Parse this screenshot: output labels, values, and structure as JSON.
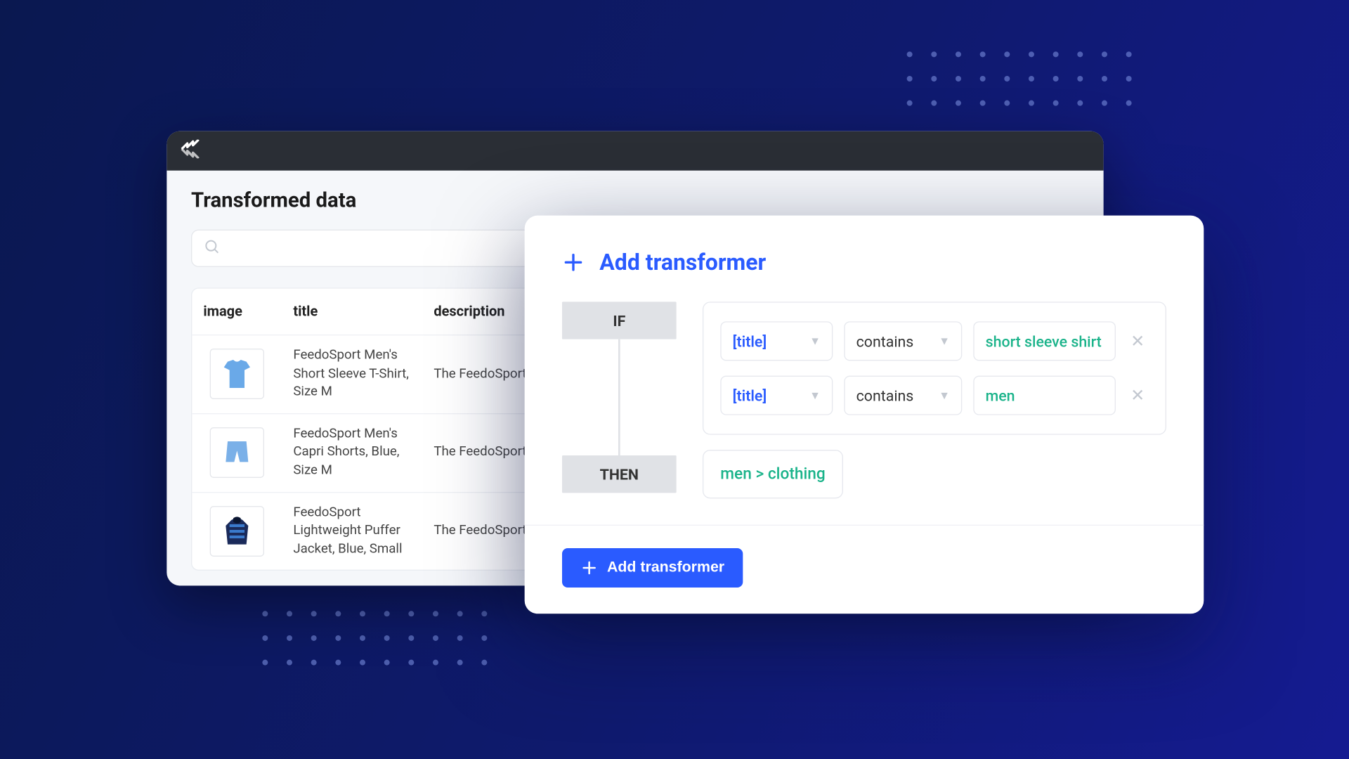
{
  "dataWindow": {
    "title": "Transformed data",
    "columns": {
      "image": "image",
      "title": "title",
      "description": "description"
    },
    "rows": [
      {
        "title": "FeedoSport Men's Short Sleeve T-Shirt, Size M",
        "desc": "The FeedoSport Short Sleeve T-Shirt is built for comfort and every day wear"
      },
      {
        "title": "FeedoSport Men's Capri Shorts, Blue, Size M",
        "desc": "The FeedoSport Capri Short is built for comfort and every day wear"
      },
      {
        "title": "FeedoSport Lightweight Puffer Jacket, Blue, Small",
        "desc": "The FeedoSport Lightweight Puffer Jacket provides ultimate warmth and"
      }
    ]
  },
  "transformer": {
    "heading": "Add transformer",
    "flow": {
      "if": "IF",
      "then": "THEN"
    },
    "conditions": [
      {
        "field": "[title]",
        "op": "contains",
        "value": "short sleeve shirt"
      },
      {
        "field": "[title]",
        "op": "contains",
        "value": "men"
      }
    ],
    "thenValue": "men > clothing",
    "addButton": "Add transformer"
  }
}
